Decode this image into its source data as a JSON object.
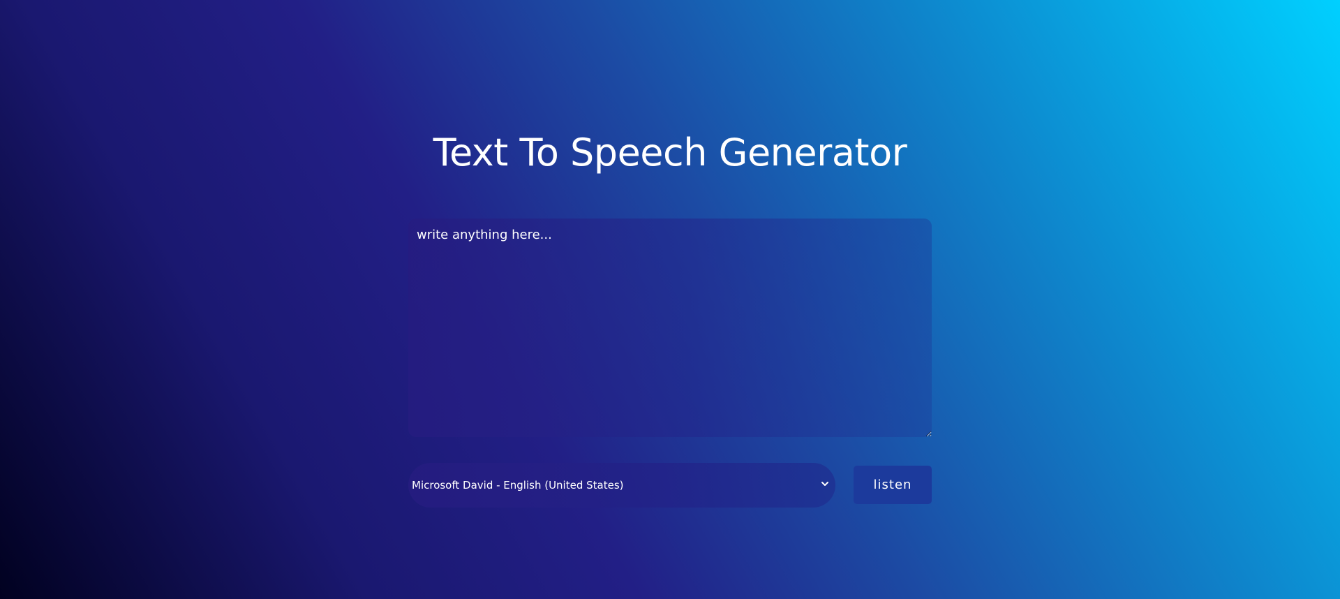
{
  "header": {
    "title": "Text To Speech Generator"
  },
  "editor": {
    "placeholder": "write anything here...",
    "value": ""
  },
  "controls": {
    "voice_selected": "Microsoft David - English (United States)",
    "listen_label": "listen",
    "chevron_icon": "chevron-down-icon"
  },
  "colors": {
    "gradient_start": "#010120",
    "gradient_mid": "#221f86",
    "gradient_end": "#00d0ff",
    "button_bg": "#1c3a9c",
    "text": "#ffffff"
  }
}
